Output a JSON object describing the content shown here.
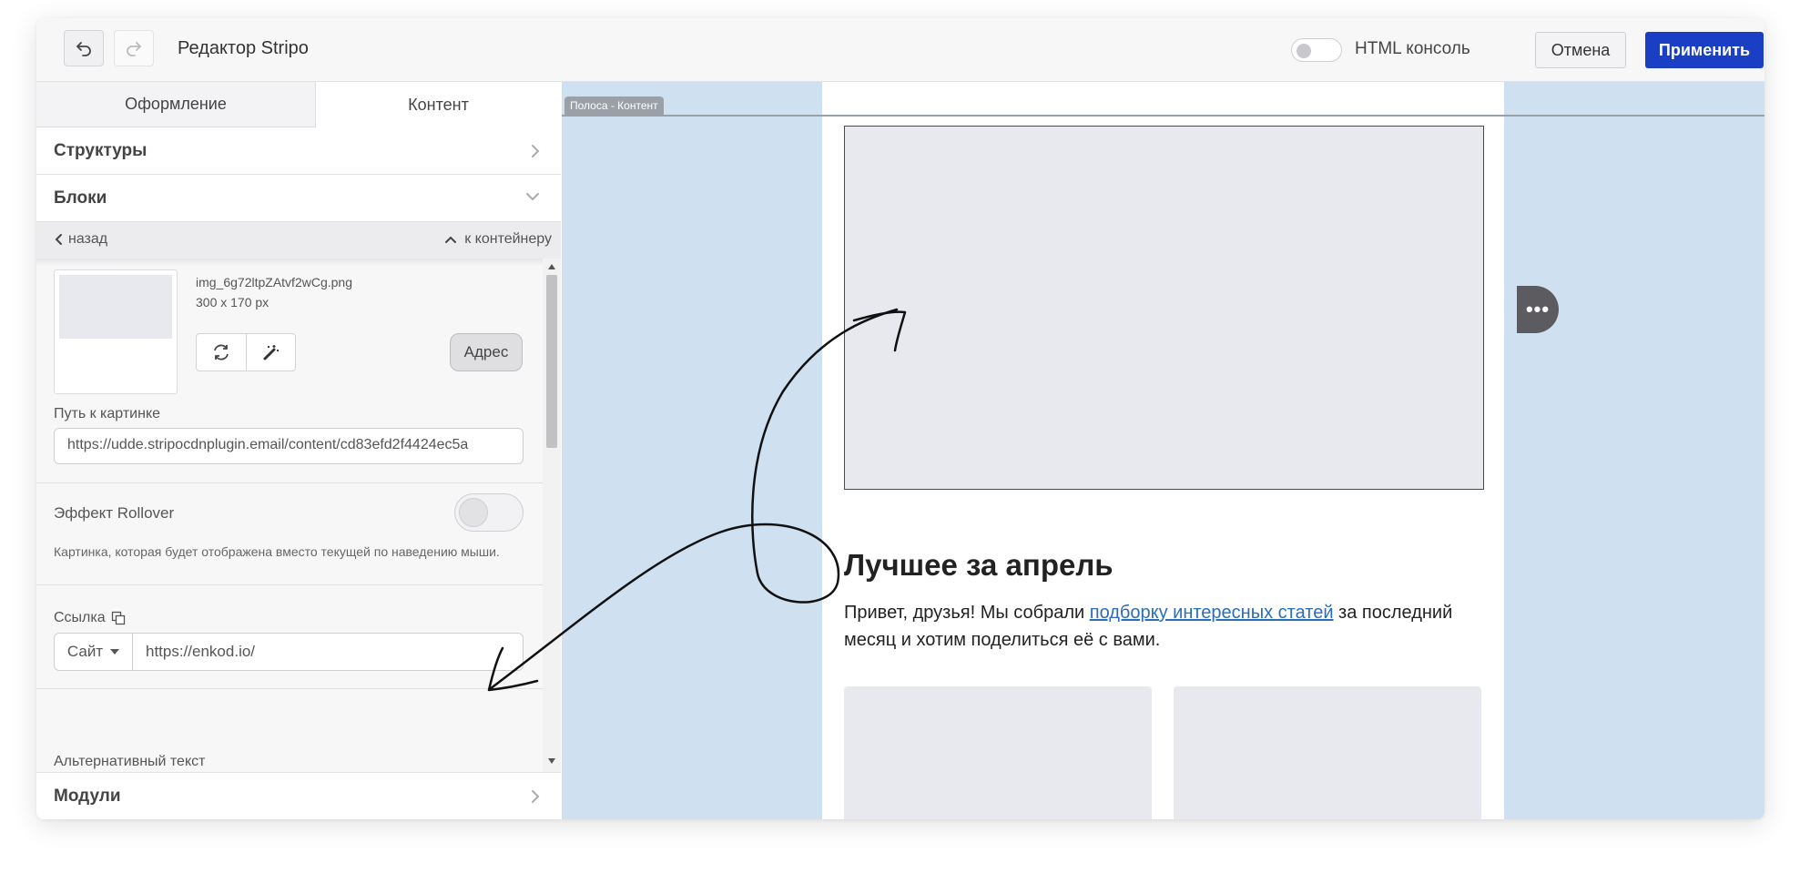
{
  "header": {
    "title": "Редактор Stripo",
    "console_label": "HTML консоль",
    "cancel_label": "Отмена",
    "apply_label": "Применить",
    "undo_icon": "undo-icon",
    "redo_icon": "redo-icon",
    "apply_color": "#1a3ec4"
  },
  "tabs": [
    {
      "label": "Оформление",
      "active": false
    },
    {
      "label": "Контент",
      "active": true
    }
  ],
  "sections": {
    "structures": "Структуры",
    "blocks": "Блоки",
    "modules": "Модули"
  },
  "nav": {
    "back_label": "назад",
    "up_label": "к контейнеру"
  },
  "image_settings": {
    "file_name": "img_6g72ltpZAtvf2wCg.png",
    "file_size": "300 x 170 px",
    "address_button": "Адрес",
    "path_label": "Путь к картинке",
    "path_value": "https://udde.stripocdnplugin.email/content/cd83efd2f4424ec5a",
    "rollover_label": "Эффект Rollover",
    "rollover_enabled": false,
    "rollover_hint": "Картинка, которая будет отображена вместо текущей по наведению мыши.",
    "link_label": "Ссылка",
    "link_type": "Сайт",
    "link_url": "https://enkod.io/",
    "alt_label": "Альтернативный текст"
  },
  "canvas": {
    "stripe_label": "Полоса - Контент",
    "email_title": "Лучшее за апрель",
    "text_before": "Привет, друзья! Мы собрали ",
    "text_link": "подборку интересных статей",
    "text_after": " за последний месяц и хотим поделиться её с вами.",
    "more_icon": "more-dots-icon",
    "background_color": "#cfe0f1"
  },
  "html_console_enabled": false
}
